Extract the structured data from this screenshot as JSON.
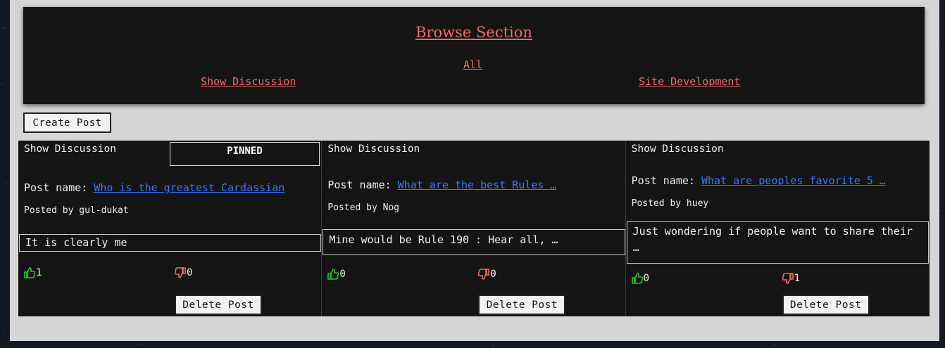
{
  "header": {
    "title": "Browse Section",
    "links": {
      "all": "All",
      "show_discussion": "Show Discussion",
      "site_development": "Site Development"
    }
  },
  "create_post_label": "Create Post",
  "posts": [
    {
      "section": "Show Discussion",
      "pinned": "PINNED",
      "post_name_label": "Post name: ",
      "title": "Who is the greatest Cardassian",
      "posted_by": "Posted by gul-dukat",
      "body": "It is clearly me",
      "upvotes": "1",
      "downvotes": "0",
      "delete_label": "Delete Post"
    },
    {
      "section": "Show Discussion",
      "post_name_label": "Post name: ",
      "title": "What are the best Rules …",
      "posted_by": "Posted by Nog",
      "body": "Mine would be Rule 190 : Hear all, …",
      "upvotes": "0",
      "downvotes": "0",
      "delete_label": "Delete Post"
    },
    {
      "section": "Show Discussion",
      "post_name_label": "Post name: ",
      "title": "What are peoples favorite 5 …",
      "posted_by": "Posted by huey",
      "body": "Just wondering if people want to share their …",
      "upvotes": "0",
      "downvotes": "1",
      "delete_label": "Delete Post"
    }
  ],
  "icons": {
    "upvote": "thumbs-up-icon",
    "downvote": "thumbs-down-icon"
  },
  "colors": {
    "link_red": "#f46a6a",
    "link_blue": "#3a78ff",
    "upvote_green": "#22cc22",
    "downvote_red": "#f46a6a",
    "card_bg": "#141414",
    "page_bg": "#d6d6d6"
  }
}
